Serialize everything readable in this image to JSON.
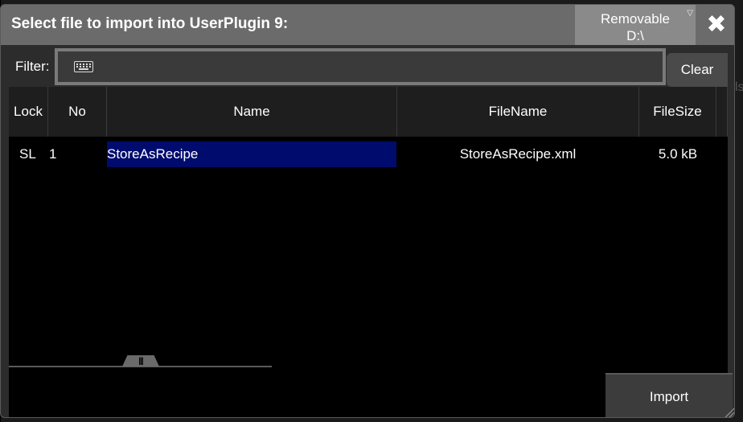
{
  "dialog": {
    "title": "Select file to import into UserPlugin 9:",
    "drive": {
      "line1": "Removable",
      "line2": "D:\\"
    },
    "close_icon": "✖"
  },
  "filter": {
    "label": "Filter:",
    "value": "",
    "icon": "keyboard-icon",
    "clear_label": "Clear"
  },
  "table": {
    "columns": [
      "Lock",
      "No",
      "Name",
      "FileName",
      "FileSize"
    ],
    "rows": [
      {
        "lock": "SL",
        "no": "1",
        "name": "StoreAsRecipe",
        "filename": "StoreAsRecipe.xml",
        "filesize": "5.0 kB"
      }
    ]
  },
  "scroll_handle_glyph": "|||",
  "import_label": "Import",
  "colors": {
    "title_bar": "#6b6b6b",
    "selection": "#000b6e",
    "background": "#000000"
  }
}
